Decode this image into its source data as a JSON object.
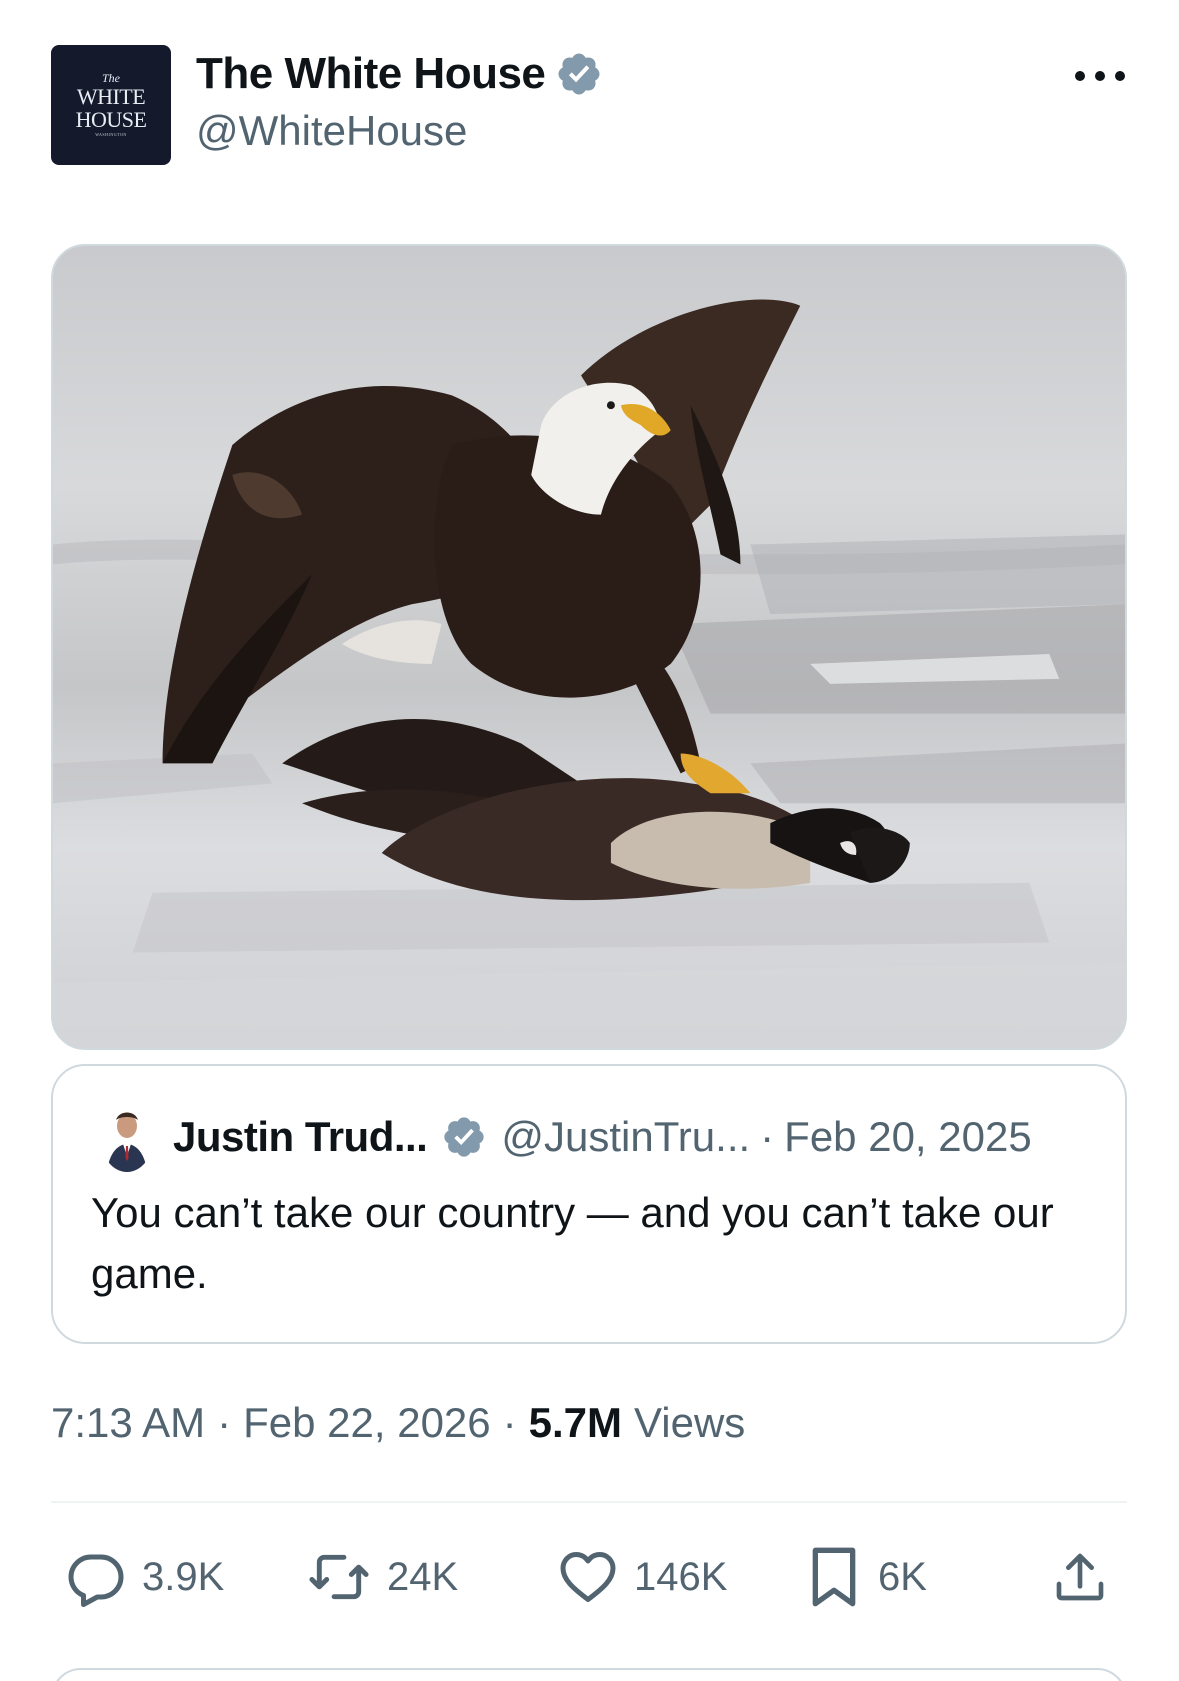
{
  "post": {
    "author": {
      "display_name": "The White House",
      "handle": "@WhiteHouse",
      "verified": true,
      "avatar_text": [
        "The",
        "WHITE",
        "HOUSE",
        "WASHINGTON"
      ],
      "avatar_color": "#141a2c"
    },
    "more_icon": "more-horizontal-icon",
    "media": {
      "icon": "eagle-catching-goose-photo"
    },
    "quoted": {
      "display_name": "Justin Trud...",
      "handle": "@JustinTru...",
      "separator": "·",
      "date": "Feb 20, 2025",
      "verified": true,
      "text": "You can’t take our country — and you can’t take our game."
    },
    "meta": {
      "time": "7:13 AM",
      "separator": "·",
      "date": "Feb 22, 2026",
      "views_count": "5.7M",
      "views_label": "Views"
    },
    "actions": {
      "replies": "3.9K",
      "reposts": "24K",
      "likes": "146K",
      "bookmarks": "6K"
    }
  },
  "colors": {
    "text_primary": "#0f1419",
    "text_secondary": "#536471",
    "border": "#cfd9de",
    "verified_badge": "#829aab"
  }
}
